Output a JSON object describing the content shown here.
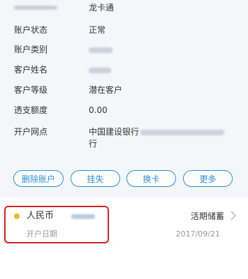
{
  "account_info": {
    "card_type": "龙卡通",
    "rows": [
      {
        "label": "账户状态",
        "value": "正常"
      },
      {
        "label": "账户类别",
        "value": ""
      },
      {
        "label": "客户姓名",
        "value": ""
      },
      {
        "label": "客户等级",
        "value": "潜在客户"
      },
      {
        "label": "透支额度",
        "value": "0.00"
      },
      {
        "label": "开户网点",
        "value": "中国建设银行",
        "value_tail": "行"
      }
    ]
  },
  "actions": {
    "delete": "删除账户",
    "report_loss": "挂失",
    "replace_card": "换卡",
    "more": "更多"
  },
  "sub_account": {
    "currency": "人民币",
    "type": "活期储蓄",
    "open_date_label": "开户日期",
    "open_date": "2017/09/21"
  },
  "colors": {
    "accent": "#2a8fd8",
    "highlight": "#d32121",
    "dot": "#f0b429"
  }
}
